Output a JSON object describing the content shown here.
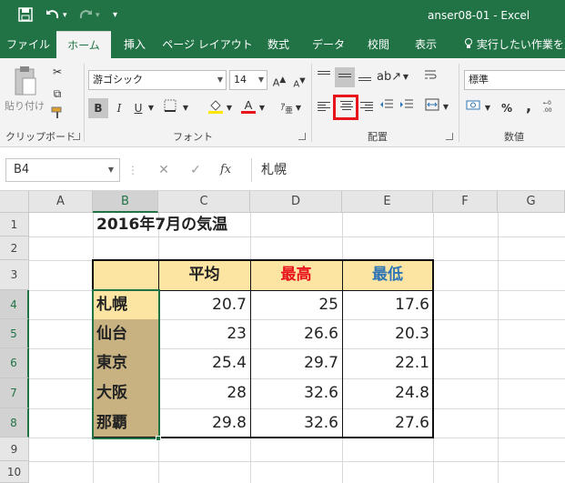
{
  "window": {
    "title": "anser08-01  -  Excel",
    "quick_access": {
      "save_icon": "save-icon",
      "undo_icon": "undo-icon",
      "redo_icon": "redo-icon",
      "customize_icon": "customize-icon"
    },
    "accent": "#217346"
  },
  "tabs": [
    {
      "label": "ファイル"
    },
    {
      "label": "ホーム",
      "active": true
    },
    {
      "label": "挿入"
    },
    {
      "label": "ページ レイアウト"
    },
    {
      "label": "数式"
    },
    {
      "label": "データ"
    },
    {
      "label": "校閲"
    },
    {
      "label": "表示"
    },
    {
      "label": "実行したい作業を入"
    }
  ],
  "ribbon": {
    "clipboard": {
      "paste_label": "貼り付け",
      "group_label": "クリップボード"
    },
    "font": {
      "font_name": "游ゴシック",
      "font_size": "14",
      "bold": "B",
      "italic": "I",
      "underline": "U",
      "group_label": "フォント",
      "font_color": "#e8131b",
      "fill_color": "#ffe600"
    },
    "alignment": {
      "group_label": "配置"
    },
    "number": {
      "format": "標準",
      "percent": "%",
      "comma": ",",
      "group_label": "数値"
    }
  },
  "formula_bar": {
    "name_box": "B4",
    "cancel_glyph": "✕",
    "enter_glyph": "✓",
    "fx_label": "fx",
    "content": "札幌"
  },
  "grid": {
    "columns": [
      "A",
      "B",
      "C",
      "D",
      "E",
      "F",
      "G"
    ],
    "rows": [
      "1",
      "2",
      "3",
      "4",
      "5",
      "6",
      "7",
      "8",
      "9",
      "10"
    ],
    "selected_column": "B",
    "selected_rows": [
      "4",
      "5",
      "6",
      "7",
      "8"
    ]
  },
  "sheet": {
    "title": "2016年7月の気温",
    "headers": [
      {
        "label": "平均",
        "color": "#111111"
      },
      {
        "label": "最高",
        "color": "#e8131b"
      },
      {
        "label": "最低",
        "color": "#2e75b6"
      }
    ],
    "rows": [
      {
        "city": "札幌",
        "avg": "20.7",
        "max": "25",
        "min": "17.6"
      },
      {
        "city": "仙台",
        "avg": "23",
        "max": "26.6",
        "min": "20.3"
      },
      {
        "city": "東京",
        "avg": "25.4",
        "max": "29.7",
        "min": "22.1"
      },
      {
        "city": "大阪",
        "avg": "28",
        "max": "32.6",
        "min": "24.8"
      },
      {
        "city": "那覇",
        "avg": "29.8",
        "max": "32.6",
        "min": "27.6"
      }
    ]
  }
}
